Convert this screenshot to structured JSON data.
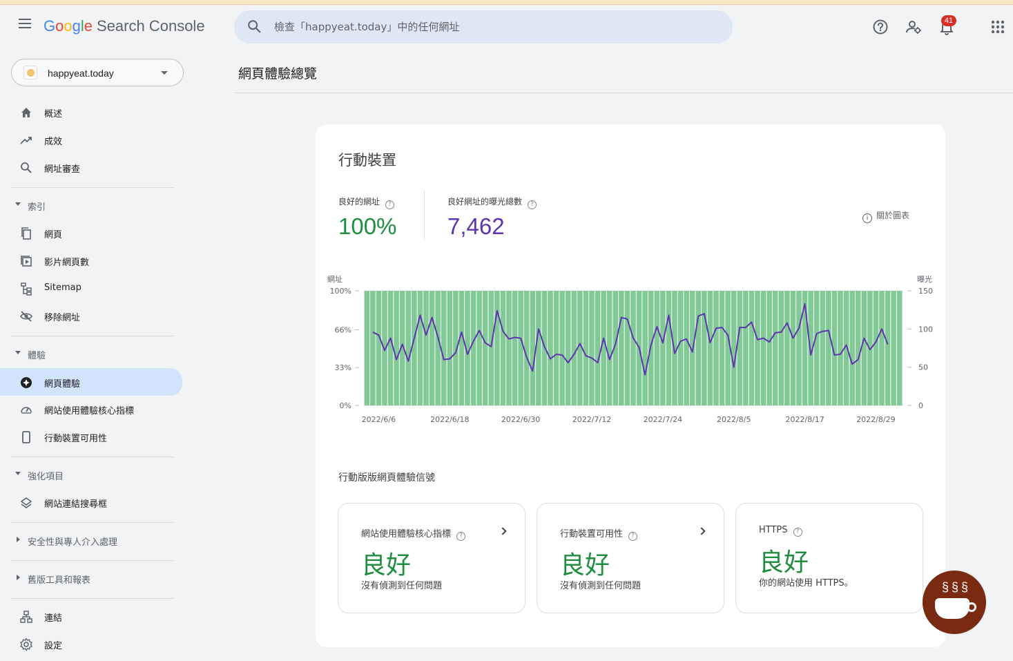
{
  "header": {
    "logo_google": [
      "G",
      "o",
      "o",
      "g",
      "l",
      "e"
    ],
    "logo_product": "Search Console",
    "search_placeholder": "檢查「happyeat.today」中的任何網址",
    "notifications_count": "41"
  },
  "sidebar": {
    "property": "happyeat.today",
    "items_top": [
      {
        "label": "概述",
        "icon": "home-icon"
      },
      {
        "label": "成效",
        "icon": "trending-up-icon"
      },
      {
        "label": "網址審查",
        "icon": "search-icon"
      }
    ],
    "section_index": "索引",
    "items_index": [
      {
        "label": "網頁",
        "icon": "pages-icon"
      },
      {
        "label": "影片網頁數",
        "icon": "video-pages-icon"
      },
      {
        "label": "Sitemap",
        "icon": "sitemap-icon"
      },
      {
        "label": "移除網址",
        "icon": "removals-icon"
      }
    ],
    "section_experience": "體驗",
    "items_experience": [
      {
        "label": "網頁體驗",
        "icon": "page-experience-icon"
      },
      {
        "label": "網站使用體驗核心指標",
        "icon": "gauge-icon"
      },
      {
        "label": "行動裝置可用性",
        "icon": "mobile-icon"
      }
    ],
    "section_enhancements": "強化項目",
    "items_enhancements": [
      {
        "label": "網站連結搜尋框",
        "icon": "layers-icon"
      }
    ],
    "section_security": "安全性與專人介入處理",
    "section_legacy": "舊版工具和報表",
    "items_bottom": [
      {
        "label": "連結",
        "icon": "links-icon"
      },
      {
        "label": "設定",
        "icon": "settings-icon"
      }
    ]
  },
  "main": {
    "page_title": "網頁體驗總覽",
    "card_title": "行動裝置",
    "metric_good_urls_label": "良好的網址",
    "metric_good_urls_value": "100%",
    "metric_impressions_label": "良好網址的曝光總數",
    "metric_impressions_value": "7,462",
    "about_chart": "關於圖表",
    "signals_title": "行動版版網頁體驗信號",
    "signals": [
      {
        "label": "網站使用體驗核心指標",
        "status": "良好",
        "desc": "沒有偵測到任何問題",
        "has_link": true
      },
      {
        "label": "行動裝置可用性",
        "status": "良好",
        "desc": "沒有偵測到任何問題",
        "has_link": true
      },
      {
        "label": "HTTPS",
        "status": "良好",
        "desc": "你的網站使用 HTTPS。",
        "has_link": false
      }
    ]
  },
  "colors": {
    "good_green": "#1e8e3e",
    "good_url_metric": "#1e8e3e",
    "impressions_purple": "#5e35b1",
    "bar_green": "#81c995",
    "line_purple": "#5e35b1",
    "active_nav": "#d2e3fc"
  },
  "chart_data": {
    "type": "bar",
    "left_axis_label": "網址",
    "right_axis_label": "曝光",
    "left_ticks": [
      "100%",
      "66%",
      "33%",
      "0%"
    ],
    "right_ticks": [
      "150",
      "100",
      "50",
      "0"
    ],
    "x_tick_labels": [
      "2022/6/6",
      "2022/6/18",
      "2022/6/30",
      "2022/7/12",
      "2022/7/24",
      "2022/8/5",
      "2022/8/17",
      "2022/8/29"
    ],
    "x_start": "2022/6/4",
    "x_end": "2022/9/2",
    "ylim_left": [
      0,
      100
    ],
    "ylim_right": [
      0,
      150
    ],
    "series": [
      {
        "name": "良好的網址",
        "kind": "bar",
        "axis": "left",
        "values": [
          100,
          100,
          100,
          100,
          100,
          100,
          100,
          100,
          100,
          100,
          100,
          100,
          100,
          100,
          100,
          100,
          100,
          100,
          100,
          100,
          100,
          100,
          100,
          100,
          100,
          100,
          100,
          100,
          100,
          100,
          100,
          100,
          100,
          100,
          100,
          100,
          100,
          100,
          100,
          100,
          100,
          100,
          100,
          100,
          100,
          100,
          100,
          100,
          100,
          100,
          100,
          100,
          100,
          100,
          100,
          100,
          100,
          100,
          100,
          100,
          100,
          100,
          100,
          100,
          100,
          100,
          100,
          100,
          100,
          100,
          100,
          100,
          100,
          100,
          100,
          100,
          100,
          100,
          100,
          100,
          100,
          100,
          100,
          100,
          100,
          100,
          100,
          100,
          100,
          100,
          100
        ]
      },
      {
        "name": "良好網址的曝光總數",
        "kind": "line",
        "axis": "right",
        "values": [
          96,
          92,
          72,
          88,
          60,
          80,
          58,
          88,
          118,
          92,
          115,
          90,
          60,
          61,
          69,
          96,
          67,
          84,
          98,
          82,
          77,
          124,
          97,
          87,
          89,
          88,
          63,
          45,
          100,
          77,
          61,
          67,
          66,
          56,
          67,
          81,
          65,
          62,
          56,
          88,
          60,
          80,
          115,
          113,
          88,
          76,
          40,
          79,
          103,
          82,
          118,
          68,
          84,
          87,
          70,
          117,
          120,
          82,
          101,
          102,
          92,
          50,
          102,
          102,
          109,
          86,
          88,
          83,
          95,
          96,
          108,
          88,
          101,
          133,
          66,
          94,
          97,
          98,
          66,
          67,
          79,
          54,
          60,
          88,
          73,
          83,
          100,
          80
        ]
      }
    ]
  }
}
